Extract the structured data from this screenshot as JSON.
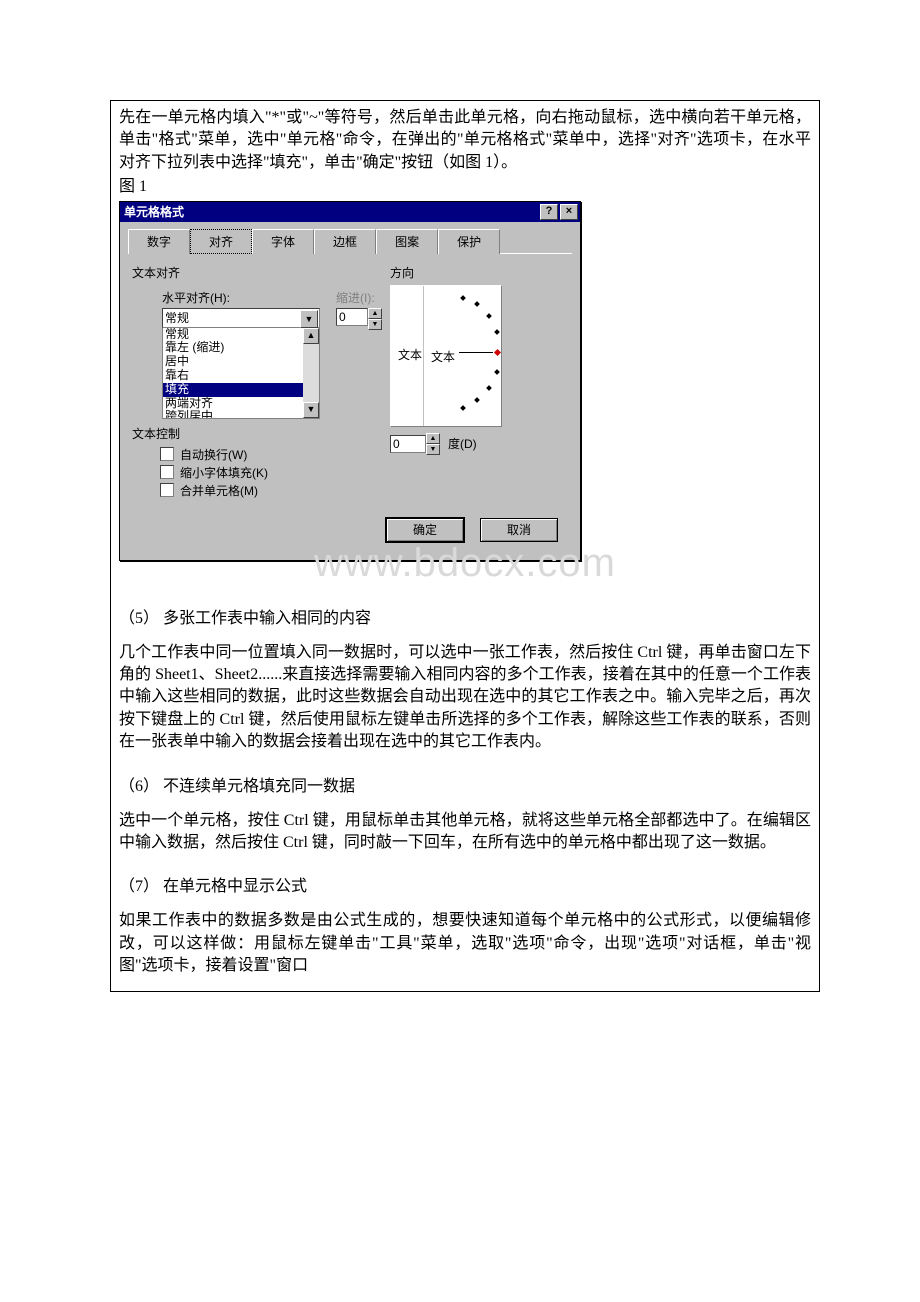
{
  "text": {
    "intro1": "先在一单元格内填入\"*\"或\"~\"等符号，然后单击此单元格，向右拖动鼠标，选中横向若干单元格，单击\"格式\"菜单，选中\"单元格\"命令，在弹出的\"单元格格式\"菜单中，选择\"对齐\"选项卡，在水平对齐下拉列表中选择\"填充\"，单击\"确定\"按钮（如图 1）。",
    "fig_label": "图 1",
    "watermark": "www.bdocx.com",
    "sec5_title": "（5） 多张工作表中输入相同的内容",
    "sec5_body": "几个工作表中同一位置填入同一数据时，可以选中一张工作表，然后按住 Ctrl 键，再单击窗口左下角的 Sheet1、Sheet2......来直接选择需要输入相同内容的多个工作表，接着在其中的任意一个工作表中输入这些相同的数据，此时这些数据会自动出现在选中的其它工作表之中。输入完毕之后，再次按下键盘上的 Ctrl 键，然后使用鼠标左键单击所选择的多个工作表，解除这些工作表的联系，否则在一张表单中输入的数据会接着出现在选中的其它工作表内。",
    "sec6_title": "（6） 不连续单元格填充同一数据",
    "sec6_body": "选中一个单元格，按住 Ctrl 键，用鼠标单击其他单元格，就将这些单元格全部都选中了。在编辑区中输入数据，然后按住 Ctrl 键，同时敲一下回车，在所有选中的单元格中都出现了这一数据。",
    "sec7_title": "（7） 在单元格中显示公式",
    "sec7_body": "如果工作表中的数据多数是由公式生成的，想要快速知道每个单元格中的公式形式，以便编辑修改，可以这样做：用鼠标左键单击\"工具\"菜单，选取\"选项\"命令，出现\"选项\"对话框，单击\"视图\"选项卡，接着设置\"窗口"
  },
  "dialog": {
    "title": "单元格格式",
    "help_btn": "?",
    "close_btn": "×",
    "tabs": [
      "数字",
      "对齐",
      "字体",
      "边框",
      "图案",
      "保护"
    ],
    "active_tab_index": 1,
    "text_align_group": "文本对齐",
    "h_align_label": "水平对齐(H):",
    "h_align_value": "常规",
    "h_align_options": [
      "常规",
      "靠左 (缩进)",
      "居中",
      "靠右",
      "填充",
      "两端对齐",
      "跨列居中"
    ],
    "h_align_selected_index": 4,
    "indent_label": "缩进(I):",
    "indent_value": "0",
    "text_control_group": "文本控制",
    "checkboxes": [
      "自动换行(W)",
      "缩小字体填充(K)",
      "合并单元格(M)"
    ],
    "orient_group": "方向",
    "orient_vertical": "文本",
    "orient_dial_label": "文本",
    "degree_value": "0",
    "degree_label": "度(D)",
    "ok": "确定",
    "cancel": "取消"
  }
}
